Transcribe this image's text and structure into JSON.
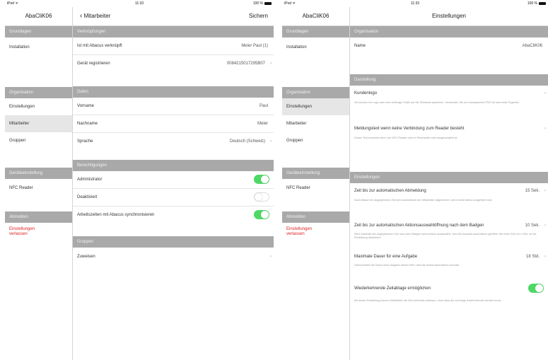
{
  "statusbar": {
    "carrier": "iPod ᯤ",
    "time": "11:33",
    "battery": "100 %"
  },
  "sidebar": {
    "title": "AbaCliK06",
    "sections": [
      {
        "header": "Grundlagen",
        "items": [
          "Installation"
        ]
      },
      {
        "header": "Organisation",
        "items": [
          "Einstellungen",
          "Mitarbeiter",
          "Gruppen"
        ]
      },
      {
        "header": "Geräteeinstellung",
        "items": [
          "NFC Reader"
        ]
      },
      {
        "header": "Abmelden",
        "items": [
          "Einstellungen verlassen"
        ]
      }
    ]
  },
  "left": {
    "nav": {
      "back": "Mitarbeiter",
      "save": "Sichern"
    },
    "sec_verknuepfungen": "Verknüpfungen",
    "abacus_label": "Ist mit Abacus verknüpft",
    "abacus_value": "Meier Paul (1)",
    "device_label": "Gerät registrieren",
    "device_value": "0084215017295B07",
    "sec_daten": "Daten",
    "vorname_label": "Vorname",
    "vorname_value": "Paul",
    "nachname_label": "Nachname",
    "nachname_value": "Meier",
    "sprache_label": "Sprache",
    "sprache_value": "Deutsch (Schweiz)",
    "sec_berechtigungen": "Berechtigungen",
    "admin_label": "Administrator",
    "deaktiviert_label": "Deaktiviert",
    "sync_label": "Arbeitszeiten mit Abacus synchronisieren",
    "sec_gruppen": "Gruppen",
    "zuweisen_label": "Zuweisen"
  },
  "right": {
    "nav_title": "Einstellungen",
    "sec_organisation": "Organisation",
    "name_label": "Name",
    "name_value": "AbaCliK06",
    "sec_darstellung": "Darstellung",
    "kundenlogo_label": "Kundenlogo",
    "kundenlogo_desc": "Sie können ein Logo oder eine beliebige Grafik auf der Startseite platzieren. Verwenden Sie ein transparentes PNG für das beste Ergebnis.",
    "meldung_label": "Meldungstext wenn keine Verbindung zum Reader besteht",
    "meldung_desc": "Dieser Text erscheint wenn der NFC-Reader nicht in Reichweite oder ausgeschaltet ist.",
    "sec_einstellungen": "Einstellungen",
    "abmeldung_label": "Zeit bis zur automatischen Abmeldung",
    "abmeldung_value": "15 Sek.",
    "abmeldung_desc": "Nach Ablauf der angegebenen Zeit wird automatisch der Mitarbeiter abgemeldet, wenn keine Aktion ausgeführt wird.",
    "oeffnung_label": "Zeit bis zur automatischen Aktionsauswahlöffnung nach dem Badgen",
    "oeffnung_value": "10 Sek.",
    "oeffnung_desc": "Wird innerhalb der angegebenen Zeit nach dem Badgen keine Aktion ausgewählt, wird die Auswahl automatisch geöffnet. Bei einer Zeit von 0 Sek. ist die Einstellung deaktiviert.",
    "dauer_label": "Maximale Dauer für eine Aufgabe",
    "dauer_value": "18 Std.",
    "dauer_desc": "Überschreitet die Dauer einer Aufgabe diesen Wert, wird die Arbeit automatisch beendet.",
    "zeitablage_label": "Wiederkehrende Zeitablage ermöglichen",
    "zeitablage_desc": "Mit dieser Einstellung können Mitarbeiter die Zeit mehrmals erfassen, ohne dass die vorherige Arbeit beendet werden muss."
  }
}
